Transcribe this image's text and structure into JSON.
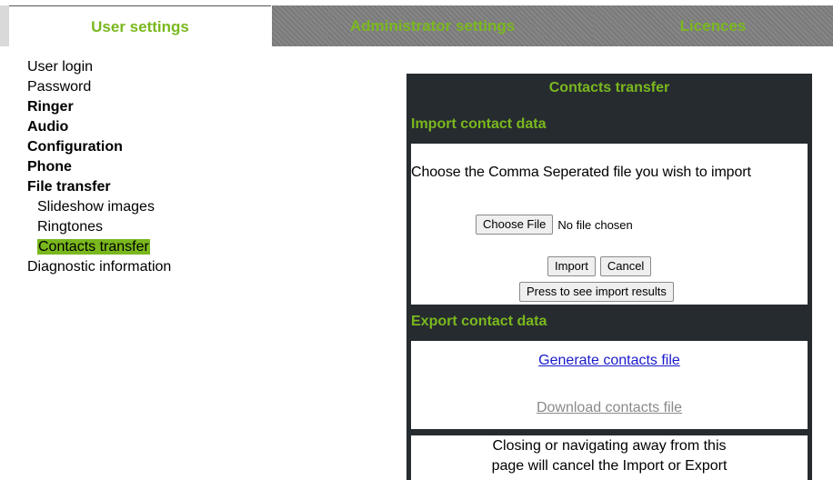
{
  "tabs": {
    "user": "User settings",
    "admin": "Administrator settings",
    "licences": "Licences"
  },
  "menu": {
    "items": [
      {
        "label": "User login"
      },
      {
        "label": "Password"
      },
      {
        "label": "Ringer"
      },
      {
        "label": "Audio"
      },
      {
        "label": "Configuration"
      },
      {
        "label": "Phone"
      },
      {
        "label": "File transfer"
      },
      {
        "label": "Slideshow images"
      },
      {
        "label": "Ringtones"
      },
      {
        "label": "Contacts transfer"
      },
      {
        "label": "Diagnostic information"
      }
    ]
  },
  "panel": {
    "title": "Contacts transfer",
    "import": {
      "heading": "Import contact data",
      "description": "Choose the Comma Seperated file you wish to import",
      "choose_file": "Choose File",
      "file_status": "No file chosen",
      "import_btn": "Import",
      "cancel_btn": "Cancel",
      "results_btn": "Press to see import results"
    },
    "export": {
      "heading": "Export contact data",
      "generate": "Generate contacts file",
      "download": "Download contacts file"
    },
    "note_line1": "Closing or navigating away from this",
    "note_line2": "page will cancel the Import or Export"
  },
  "colors": {
    "accent": "#7ab81e",
    "panel_bg": "#262b30",
    "tab_inactive": "#7f7f7f",
    "link": "#1a1acc",
    "link_disabled": "#8a8a8a"
  }
}
